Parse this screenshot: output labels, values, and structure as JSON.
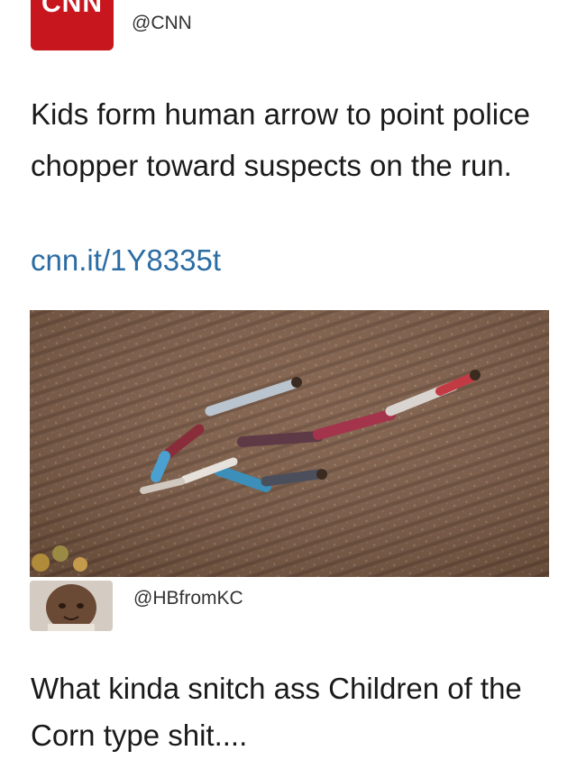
{
  "tweet1": {
    "logo_text": "CNN",
    "handle": "@CNN",
    "text": "Kids form human arrow to point police chopper toward suspects on the run.",
    "link": "cnn.it/1Y8335t"
  },
  "tweet2": {
    "handle": "@HBfromKC",
    "text": "What kinda snitch ass Children of the Corn type shit...."
  },
  "colors": {
    "cnn_red": "#c7161d",
    "link_blue": "#2b6ca3",
    "field_brown": "#7a5a44"
  },
  "icons": {
    "logo": "cnn-logo",
    "avatar": "baby-avatar"
  }
}
